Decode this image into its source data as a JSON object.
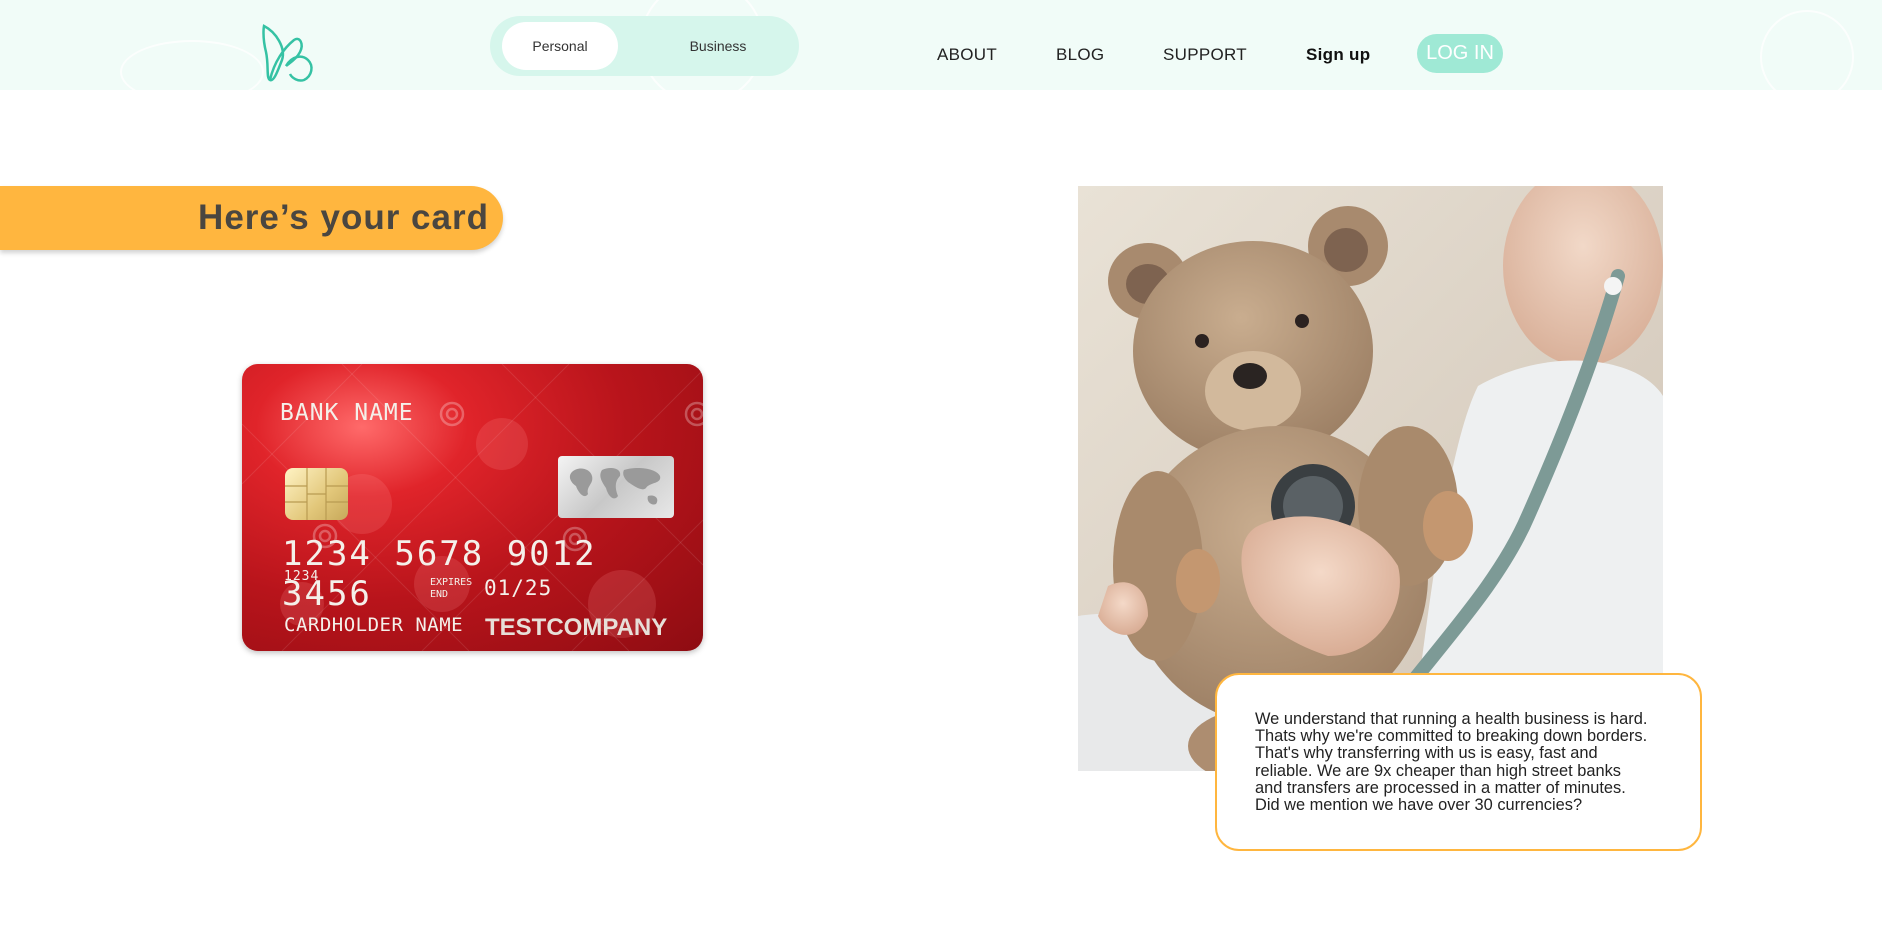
{
  "header": {
    "toggle": {
      "personal_label": "Personal",
      "business_label": "Business"
    },
    "nav": {
      "about": "ABOUT",
      "blog": "BLOG",
      "support": "SUPPORT",
      "signup": "Sign up",
      "login": "LOG IN"
    }
  },
  "banner": {
    "title": "Here’s your card"
  },
  "card": {
    "bank_name": "BANK NAME",
    "number": "1234 5678 9012 3456",
    "sub_number": "1234",
    "expires_label_1": "EXPIRES",
    "expires_label_2": "END",
    "expiry": "01/25",
    "holder": "CARDHOLDER NAME",
    "company": "TESTCOMPANY"
  },
  "textbox": {
    "lines": [
      "We understand that running a health business is hard.",
      "Thats why we're committed to breaking down borders.",
      "That's why transferring with us is easy, fast and",
      "reliable. We are 9x cheaper than high street banks",
      "and transfers are processed in a matter of minutes.",
      "Did we mention we have over 30 currencies?"
    ]
  },
  "colors": {
    "header_bg": "#f1fcf8",
    "toggle_bg": "#d6f6ec",
    "login_bg": "#9fe9d5",
    "accent_orange": "#ffb63f",
    "logo": "#35c2a4",
    "card_red": "#c0141c"
  },
  "icons": {
    "logo": "brand-logo-icon",
    "card_chip": "chip-icon",
    "card_map": "world-map-icon"
  }
}
